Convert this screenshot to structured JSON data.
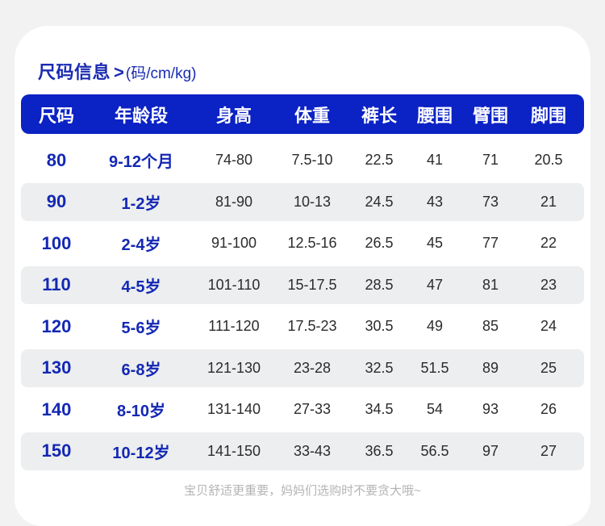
{
  "title": {
    "main": "尺码信息",
    "arrow": ">",
    "unit": "(码/cm/kg)"
  },
  "table": {
    "headers": [
      "尺码",
      "年龄段",
      "身高",
      "体重",
      "裤长",
      "腰围",
      "臂围",
      "脚围"
    ],
    "rows": [
      [
        "80",
        "9-12个月",
        "74-80",
        "7.5-10",
        "22.5",
        "41",
        "71",
        "20.5"
      ],
      [
        "90",
        "1-2岁",
        "81-90",
        "10-13",
        "24.5",
        "43",
        "73",
        "21"
      ],
      [
        "100",
        "2-4岁",
        "91-100",
        "12.5-16",
        "26.5",
        "45",
        "77",
        "22"
      ],
      [
        "110",
        "4-5岁",
        "101-110",
        "15-17.5",
        "28.5",
        "47",
        "81",
        "23"
      ],
      [
        "120",
        "5-6岁",
        "111-120",
        "17.5-23",
        "30.5",
        "49",
        "85",
        "24"
      ],
      [
        "130",
        "6-8岁",
        "121-130",
        "23-28",
        "32.5",
        "51.5",
        "89",
        "25"
      ],
      [
        "140",
        "8-10岁",
        "131-140",
        "27-33",
        "34.5",
        "54",
        "93",
        "26"
      ],
      [
        "150",
        "10-12岁",
        "141-150",
        "33-43",
        "36.5",
        "56.5",
        "97",
        "27"
      ]
    ]
  },
  "footer": "宝贝舒适更重要，妈妈们选购时不要贪大哦~",
  "colors": {
    "brand_blue": "#0b22c4",
    "text_blue": "#1428b4",
    "stripe_gray": "#eceeef"
  }
}
